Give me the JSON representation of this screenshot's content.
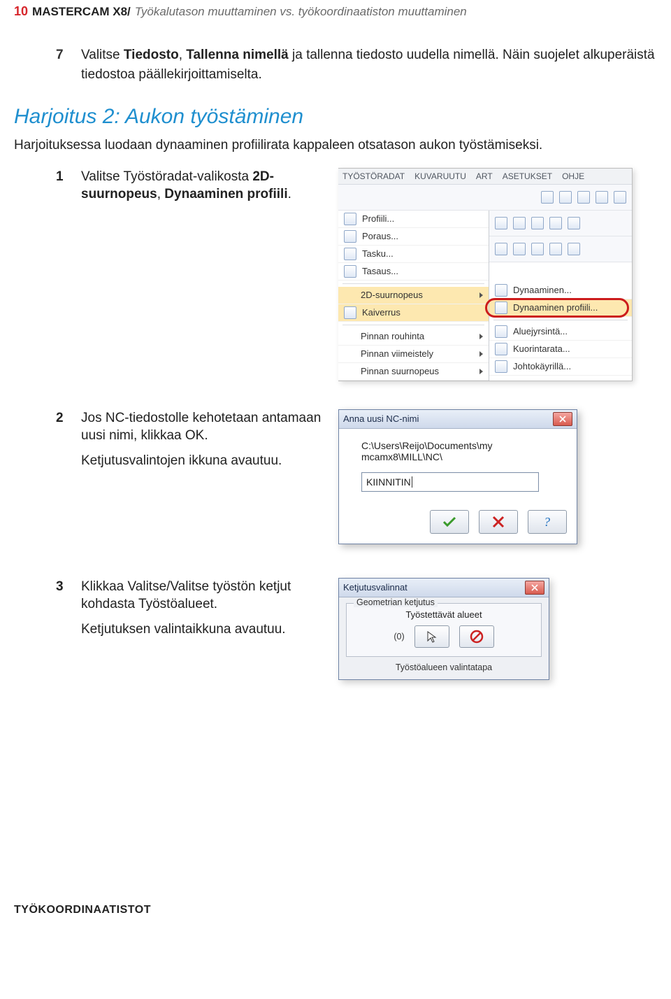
{
  "header": {
    "page_number": "10",
    "title_bold": "MASTERCAM X8/",
    "title_sub": "Työkalutason muuttaminen vs. työkoordinaatiston muuttaminen"
  },
  "step7": {
    "num": "7",
    "pre": "Valitse ",
    "b1": "Tiedosto",
    "mid1": ", ",
    "b2": "Tallenna nimellä",
    "post": " ja tallenna tiedosto uudella nimellä. Näin suojelet alkuperäistä tiedostoa päällekirjoittamiselta."
  },
  "exercise": {
    "title": "Harjoitus 2: Aukon työstäminen",
    "intro": "Harjoituksessa luodaan dynaaminen profiilirata kappaleen otsatason aukon työstämiseksi."
  },
  "step1": {
    "num": "1",
    "pre": "Valitse Työstöradat-valikosta ",
    "b1": "2D-suurnopeus",
    "mid": ", ",
    "b2": "Dynaaminen profiili",
    "post": "."
  },
  "menu": {
    "tabs": [
      "TYÖSTÖRADAT",
      "KUVARUUTU",
      "ART",
      "ASETUKSET",
      "OHJE"
    ],
    "left": [
      {
        "label": "Profiili...",
        "kind": "item"
      },
      {
        "label": "Poraus...",
        "kind": "item"
      },
      {
        "label": "Tasku...",
        "kind": "item"
      },
      {
        "label": "Tasaus...",
        "kind": "item"
      },
      {
        "kind": "div"
      },
      {
        "label": "2D-suurnopeus",
        "kind": "sub",
        "selected": true
      },
      {
        "label": "Kaiverrus",
        "kind": "item",
        "selected": true
      },
      {
        "kind": "div"
      },
      {
        "label": "Pinnan rouhinta",
        "kind": "sub"
      },
      {
        "label": "Pinnan viimeistely",
        "kind": "sub"
      },
      {
        "label": "Pinnan suurnopeus",
        "kind": "sub"
      }
    ],
    "right": [
      {
        "label": "Dynaaminen...",
        "kind": "item"
      },
      {
        "label": "Dynaaminen profiili...",
        "kind": "item",
        "circled": true
      },
      {
        "kind": "div"
      },
      {
        "label": "Aluejyrsintä...",
        "kind": "item"
      },
      {
        "label": "Kuorintarata...",
        "kind": "item"
      },
      {
        "label": "Johtokäyrillä...",
        "kind": "item"
      }
    ]
  },
  "step2": {
    "num": "2",
    "line1": "Jos NC-tiedostolle kehotetaan antamaan uusi nimi, klikkaa OK.",
    "line2": "Ketjutusvalintojen ikkuna avautuu."
  },
  "dialog1": {
    "title": "Anna uusi NC-nimi",
    "path": "C:\\Users\\Reijo\\Documents\\my mcamx8\\MILL\\NC\\",
    "input_value": "KIINNITIN"
  },
  "step3": {
    "num": "3",
    "line1": "Klikkaa Valitse/Valitse työstön ketjut kohdasta Työstöalueet.",
    "line2": "Ketjutuksen valintaikkuna avautuu."
  },
  "dialog2": {
    "title": "Ketjutusvalinnat",
    "group_legend": "Geometrian ketjutus",
    "region_label": "Työstettävät alueet",
    "count": "(0)",
    "bottom_label": "Työstöalueen valintatapa"
  },
  "footer": "TYÖKOORDINAATISTOT"
}
